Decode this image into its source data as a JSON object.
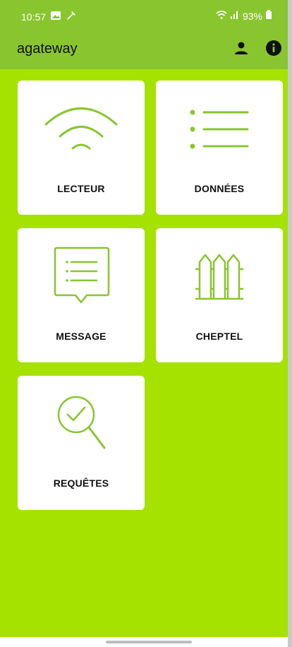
{
  "status_bar": {
    "time": "10:57",
    "battery": "93%",
    "icons_left": [
      "gallery-icon",
      "tools-icon"
    ],
    "icons_right": [
      "wifi-icon",
      "signal-icon",
      "battery-icon"
    ]
  },
  "app_bar": {
    "title": "agateway",
    "actions": [
      "account-icon",
      "info-icon"
    ]
  },
  "tiles": [
    {
      "label": "LECTEUR",
      "icon": "wifi-icon"
    },
    {
      "label": "DONNÉES",
      "icon": "list-icon"
    },
    {
      "label": "MESSAGE",
      "icon": "message-icon"
    },
    {
      "label": "CHEPTEL",
      "icon": "fence-icon"
    },
    {
      "label": "REQUÊTES",
      "icon": "search-check-icon"
    }
  ],
  "colors": {
    "background": "#a5e200",
    "app_bar": "#89c52f",
    "icon_stroke": "#89c52f",
    "card": "#ffffff"
  }
}
